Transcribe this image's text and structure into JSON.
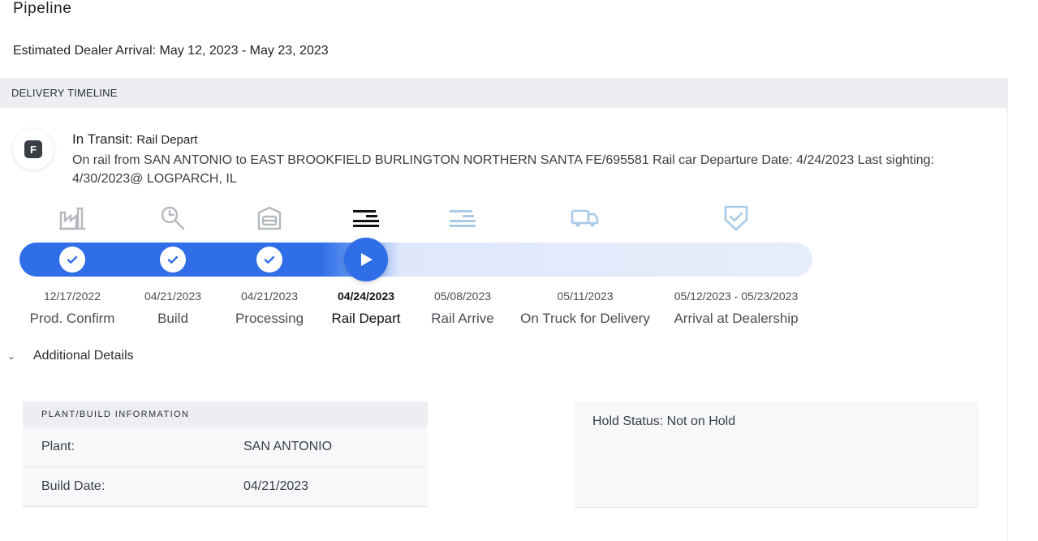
{
  "page": {
    "title": "Pipeline",
    "estimated_arrival": "Estimated Dealer Arrival: May 12, 2023 - May 23, 2023"
  },
  "timeline": {
    "header": "DELIVERY TIMELINE",
    "status_badge": "F",
    "status_label": "In Transit:",
    "status_sub": "Rail Depart",
    "status_description": "On rail from SAN ANTONIO to EAST BROOKFIELD BURLINGTON NORTHERN SANTA FE/695581 Rail car Departure Date: 4/24/2023 Last sighting: 4/30/2023@ LOGPARCH, IL",
    "progress_fraction": 0.45,
    "steps": [
      {
        "date": "12/17/2022",
        "label": "Prod. Confirm",
        "state": "done",
        "icon": "factory-icon"
      },
      {
        "date": "04/21/2023",
        "label": "Build",
        "state": "done",
        "icon": "wrench-icon"
      },
      {
        "date": "04/21/2023",
        "label": "Processing",
        "state": "done",
        "icon": "garage-icon"
      },
      {
        "date": "04/24/2023",
        "label": "Rail Depart",
        "state": "current",
        "icon": "rail-icon"
      },
      {
        "date": "05/08/2023",
        "label": "Rail Arrive",
        "state": "pending",
        "icon": "rail-icon"
      },
      {
        "date": "05/11/2023",
        "label": "On Truck for Delivery",
        "state": "pending",
        "icon": "truck-icon"
      },
      {
        "date": "05/12/2023 - 05/23/2023",
        "label": "Arrival at Dealership",
        "state": "pending",
        "icon": "shield-check-icon"
      }
    ],
    "colors": {
      "done": "#2f6ee6",
      "pending_icon": "#a9cbe8",
      "done_icon": "#b5b9be",
      "current_icon": "#111111"
    }
  },
  "additional_details": {
    "label": "Additional Details",
    "plant_info": {
      "header": "PLANT/BUILD INFORMATION",
      "rows": [
        {
          "key": "Plant:",
          "value": "SAN ANTONIO"
        },
        {
          "key": "Build Date:",
          "value": "04/21/2023"
        }
      ]
    },
    "hold_status": "Hold Status: Not on Hold"
  }
}
